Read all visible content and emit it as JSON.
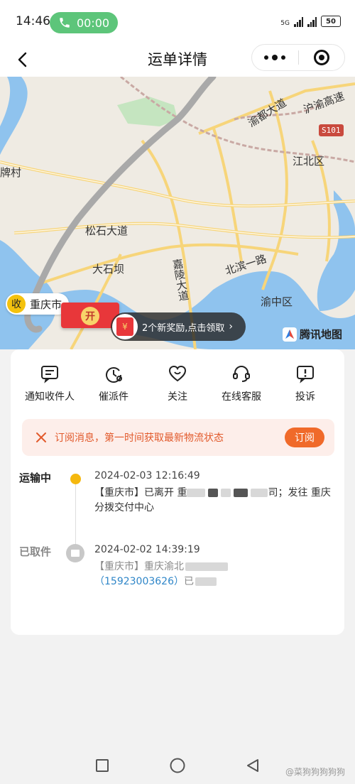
{
  "status_bar": {
    "time": "14:46",
    "call_timer": "00:00",
    "network_5g": "5G",
    "battery": "50"
  },
  "nav": {
    "title": "运单详情"
  },
  "map": {
    "labels": {
      "yuzhong": "渝中区",
      "jiangbei": "江北区",
      "dashiba": "大石坝",
      "songshi": "松石大道",
      "jialing": "嘉陵大道",
      "beibin": "北滨一路",
      "yudu": "渝都大道",
      "huyu": "沪渝高速",
      "pai_cun": "牌村",
      "s101": "S101"
    },
    "receiver_pin": {
      "badge": "收",
      "city": "重庆市"
    },
    "envelope_label": "开",
    "reward": {
      "text": "2个新奖励,点击领取",
      "gift_icon": "¥"
    },
    "logo": "腾讯地图"
  },
  "actions": [
    {
      "label": "通知收件人",
      "icon": "message-icon"
    },
    {
      "label": "催派件",
      "icon": "timer-icon"
    },
    {
      "label": "关注",
      "icon": "heart-icon"
    },
    {
      "label": "在线客服",
      "icon": "headset-icon"
    },
    {
      "label": "投诉",
      "icon": "complaint-icon"
    }
  ],
  "subscribe": {
    "message": "订阅消息，第一时间获取最新物流状态",
    "button": "订阅"
  },
  "timeline": [
    {
      "status": "运输中",
      "time": "2024-02-03 12:16:49",
      "text_a": "【重庆市】已离开 重",
      "text_b": "司；发往 重庆",
      "text_c": "分拨交付中心"
    },
    {
      "status": "已取件",
      "time": "2024-02-02 14:39:19",
      "text_a": "【重庆市】重庆渝北",
      "phone": "（15923003626）",
      "text_b": "已"
    }
  ],
  "watermark": "@菜狗狗狗狗狗",
  "colors": {
    "accent": "#f06a2a",
    "pill_green": "#5dc57a",
    "dot_yellow": "#f5b80e",
    "link": "#2f86c8"
  }
}
